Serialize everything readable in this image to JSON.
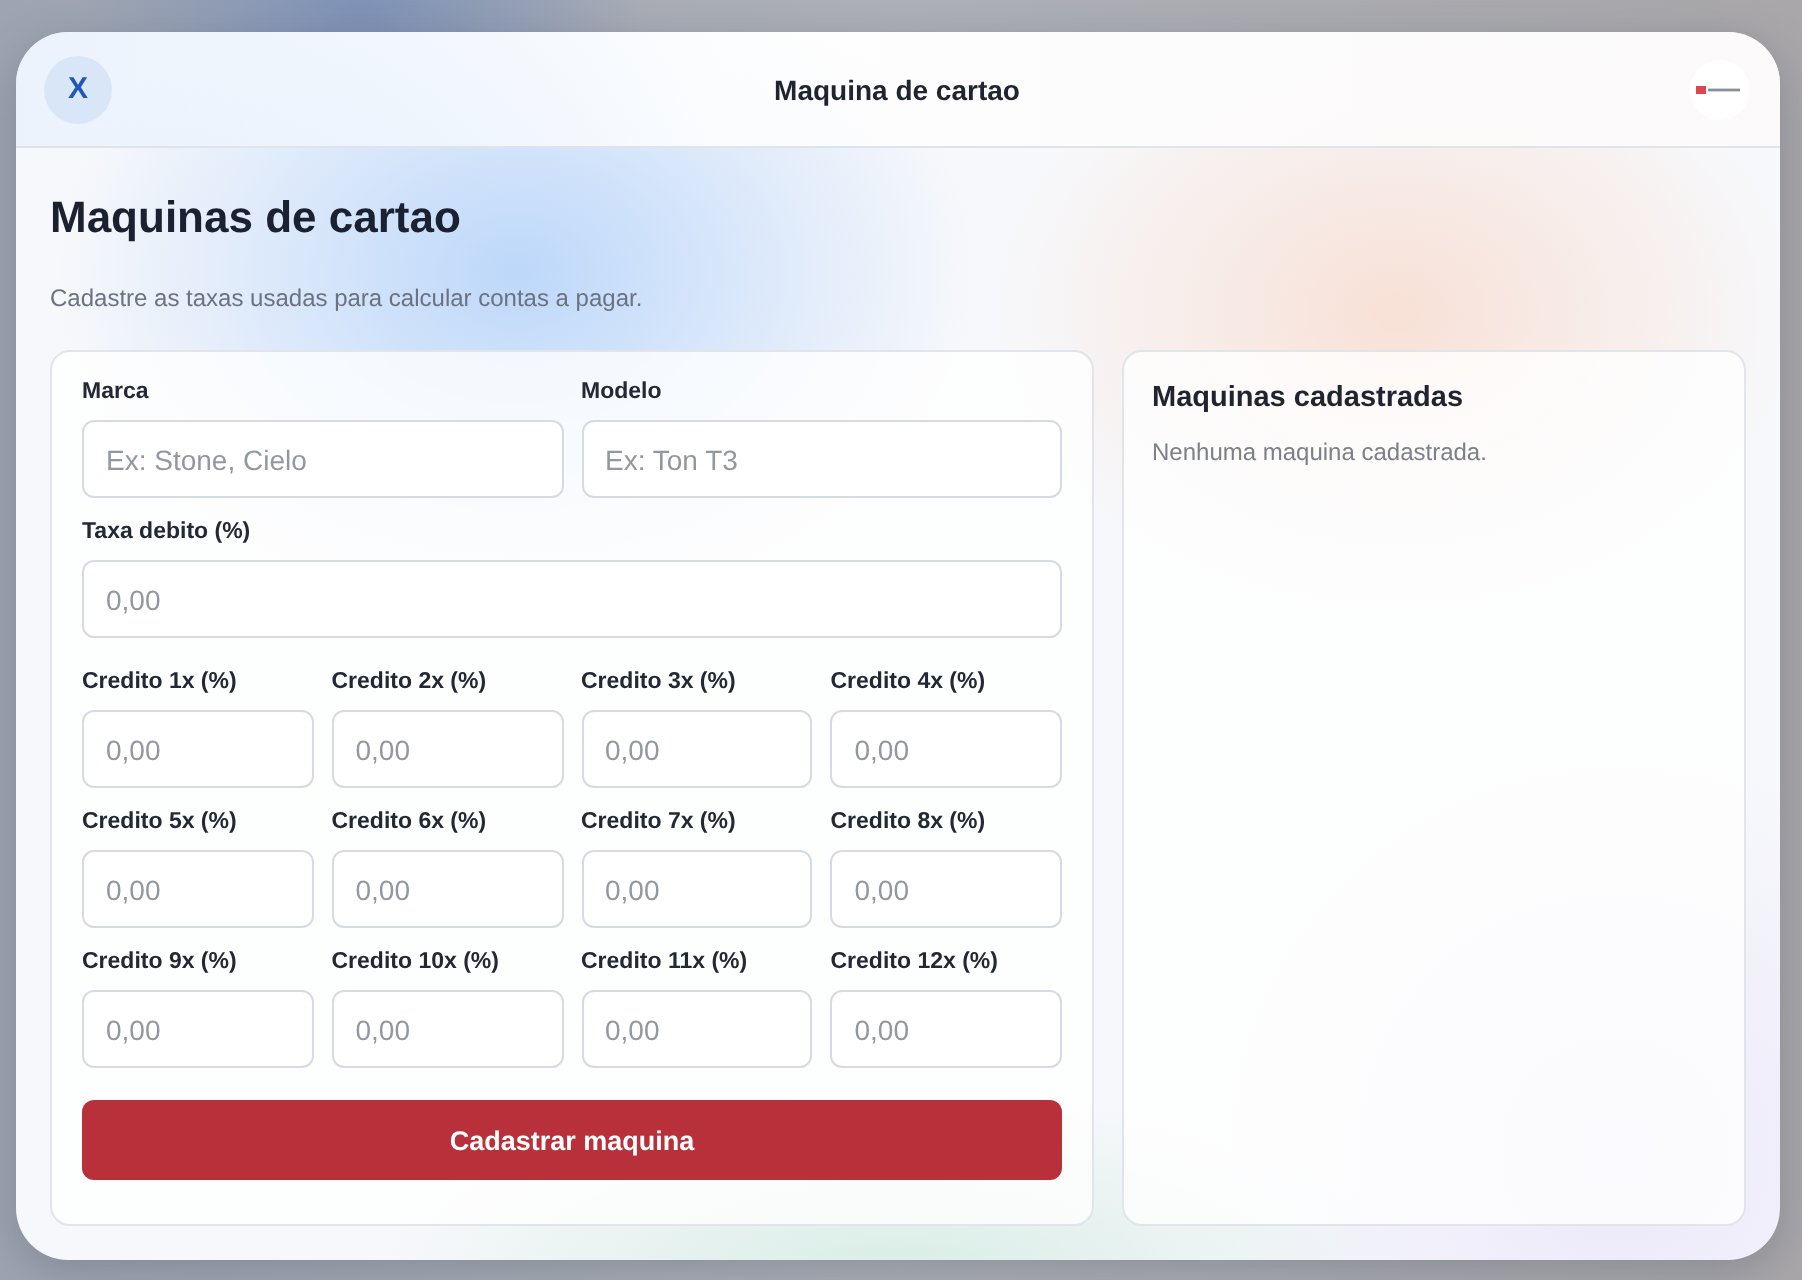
{
  "window": {
    "title": "Maquina de cartao",
    "close_button": "X"
  },
  "page": {
    "heading": "Maquinas de cartao",
    "subtitle": "Cadastre as taxas usadas para calcular contas a pagar."
  },
  "form": {
    "top_fields": [
      {
        "label": "Marca",
        "placeholder": "Ex: Stone, Cielo"
      },
      {
        "label": "Modelo",
        "placeholder": "Ex: Ton T3"
      }
    ],
    "debit_field": {
      "label": "Taxa debito (%)",
      "placeholder": "0,00"
    },
    "credit_fields": [
      {
        "label": "Credito 1x (%)",
        "placeholder": "0,00"
      },
      {
        "label": "Credito 2x (%)",
        "placeholder": "0,00"
      },
      {
        "label": "Credito 3x (%)",
        "placeholder": "0,00"
      },
      {
        "label": "Credito 4x (%)",
        "placeholder": "0,00"
      },
      {
        "label": "Credito 5x (%)",
        "placeholder": "0,00"
      },
      {
        "label": "Credito 6x (%)",
        "placeholder": "0,00"
      },
      {
        "label": "Credito 7x (%)",
        "placeholder": "0,00"
      },
      {
        "label": "Credito 8x (%)",
        "placeholder": "0,00"
      },
      {
        "label": "Credito 9x (%)",
        "placeholder": "0,00"
      },
      {
        "label": "Credito 10x (%)",
        "placeholder": "0,00"
      },
      {
        "label": "Credito 11x (%)",
        "placeholder": "0,00"
      },
      {
        "label": "Credito 12x (%)",
        "placeholder": "0,00"
      }
    ],
    "submit_button": "Cadastrar maquina"
  },
  "list": {
    "title": "Maquinas cadastradas",
    "empty_message": "Nenhuma maquina cadastrada."
  }
}
